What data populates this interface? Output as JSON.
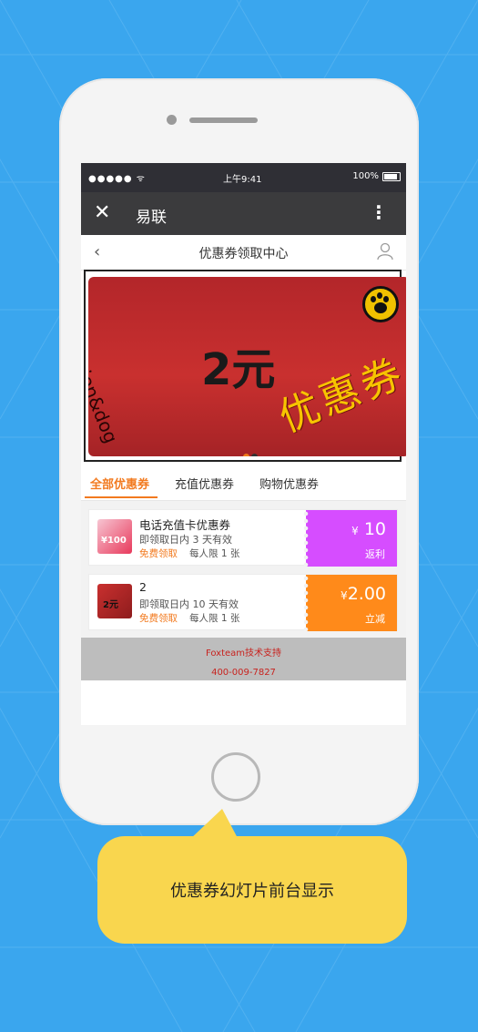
{
  "status_bar": {
    "carrier": "●●●●● ᯤ",
    "time": "上午9:41",
    "battery": "100%"
  },
  "app_nav": {
    "close_icon": "close-icon",
    "title": "易联",
    "more_icon": "more-vertical-icon"
  },
  "page_header": {
    "back_icon": "chevron-left-icon",
    "title": "优惠券领取中心",
    "user_icon": "user-icon"
  },
  "banner": {
    "amount": "2元",
    "stamp_text": "优惠券",
    "brand": "fashion&dog",
    "slides": 2,
    "active_slide": 1
  },
  "tabs": [
    {
      "label": "全部优惠券",
      "active": true
    },
    {
      "label": "充值优惠券",
      "active": false
    },
    {
      "label": "购物优惠券",
      "active": false
    }
  ],
  "coupons": [
    {
      "name": "电话充值卡优惠券",
      "validity": "即领取日内 3 天有效",
      "free_label": "免费领取",
      "limit": "每人限 1 张",
      "currency": "¥",
      "value": "10",
      "kind": "返利",
      "thumb_text": "¥100",
      "side_color": "#d64dff"
    },
    {
      "name": "2",
      "validity": "即领取日内 10 天有效",
      "free_label": "免费领取",
      "limit": "每人限 1 张",
      "currency": "¥",
      "value": "2.00",
      "kind": "立减",
      "thumb_text": "2元",
      "side_color": "#ff8a1a"
    }
  ],
  "footer": {
    "support": "Foxteam技术支持",
    "phone": "400-009-7827"
  },
  "caption": "优惠券幻灯片前台显示",
  "colors": {
    "background": "#3aa6ee",
    "accent": "#f27a1f",
    "bubble": "#f9d64e",
    "nav": "#3b3b3d"
  }
}
